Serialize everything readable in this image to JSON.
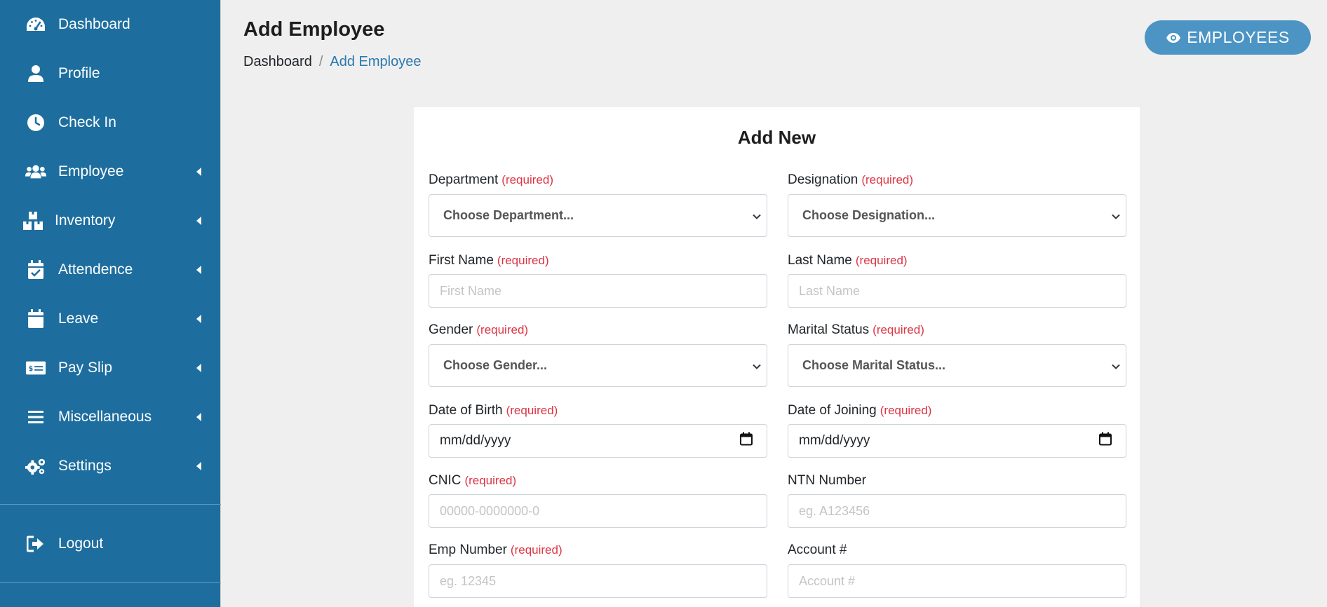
{
  "sidebar": {
    "items": [
      {
        "label": "Dashboard",
        "icon": "tachometer-icon"
      },
      {
        "label": "Profile",
        "icon": "user-icon"
      },
      {
        "label": "Check In",
        "icon": "clock-icon"
      },
      {
        "label": "Employee",
        "icon": "users-icon",
        "expandable": true
      },
      {
        "label": "Inventory",
        "icon": "boxes-icon",
        "expandable": true
      },
      {
        "label": "Attendence",
        "icon": "calendar-check-icon",
        "expandable": true
      },
      {
        "label": "Leave",
        "icon": "calendar-icon",
        "expandable": true
      },
      {
        "label": "Pay Slip",
        "icon": "money-check-icon",
        "expandable": true
      },
      {
        "label": "Miscellaneous",
        "icon": "bars-icon",
        "expandable": true
      },
      {
        "label": "Settings",
        "icon": "cogs-icon",
        "expandable": true
      }
    ],
    "logout_label": "Logout"
  },
  "header": {
    "title": "Add Employee",
    "breadcrumb": {
      "home": "Dashboard",
      "separator": "/",
      "current": "Add Employee"
    },
    "employees_button": "EMPLOYEES"
  },
  "form": {
    "title": "Add New",
    "required_text": "(required)",
    "department": {
      "label": "Department",
      "value": "Choose Department..."
    },
    "designation": {
      "label": "Designation",
      "value": "Choose Designation..."
    },
    "first_name": {
      "label": "First Name",
      "placeholder": "First Name"
    },
    "last_name": {
      "label": "Last Name",
      "placeholder": "Last Name"
    },
    "gender": {
      "label": "Gender",
      "value": "Choose Gender..."
    },
    "marital_status": {
      "label": "Marital Status",
      "value": "Choose Marital Status..."
    },
    "dob": {
      "label": "Date of Birth",
      "value": "mm/dd/yyyy"
    },
    "doj": {
      "label": "Date of Joining",
      "value": "mm/dd/yyyy"
    },
    "cnic": {
      "label": "CNIC",
      "placeholder": "00000-0000000-0"
    },
    "ntn": {
      "label": "NTN Number",
      "placeholder": "eg. A123456"
    },
    "emp_number": {
      "label": "Emp Number",
      "placeholder": "eg. 12345"
    },
    "account": {
      "label": "Account #",
      "placeholder": "Account #"
    }
  },
  "colors": {
    "sidebar": "#1d6e9f",
    "accent_button": "#4b94c4",
    "required": "#dc3545",
    "breadcrumb_active": "#2a78b0"
  }
}
